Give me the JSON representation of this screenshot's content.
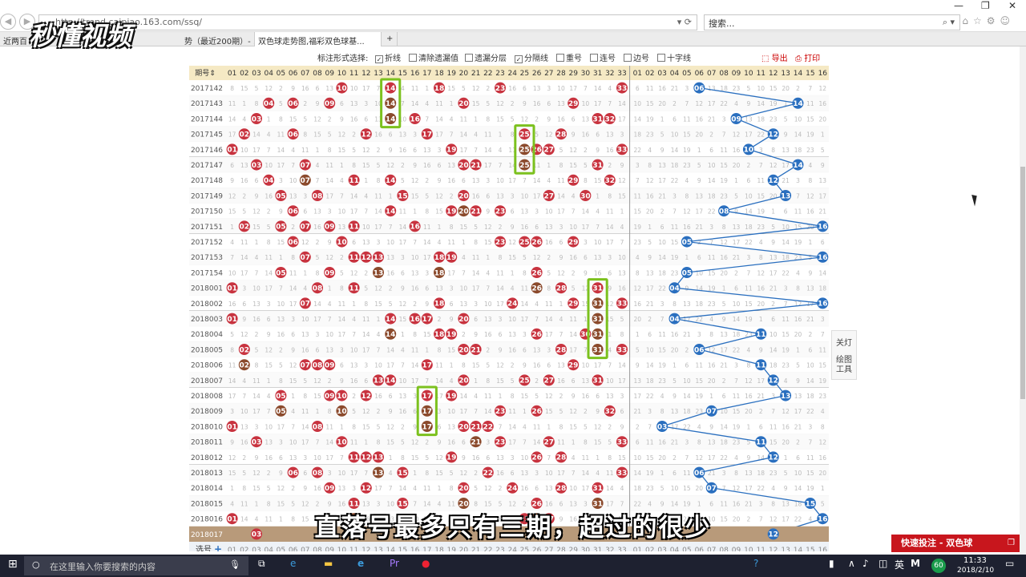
{
  "browser": {
    "address": "http://trend.caipiao.163.com/ssq/",
    "search_placeholder": "搜索...",
    "back_icon": "back-arrow-icon",
    "forward_icon": "forward-arrow-icon"
  },
  "tabs": [
    {
      "label": "近两百",
      "active": false
    },
    {
      "label": "势（最近200期）- ...",
      "active": false
    },
    {
      "label": "双色球走势图,福彩双色球基...",
      "active": true
    }
  ],
  "watermark": {
    "logo": "秒懂视频"
  },
  "toolbar": {
    "label": "标注形式选择:",
    "options": [
      {
        "label": "折线",
        "checked": true
      },
      {
        "label": "清除遗漏值",
        "checked": false
      },
      {
        "label": "遗漏分层",
        "checked": false
      },
      {
        "label": "分隔线",
        "checked": true
      },
      {
        "label": "重号",
        "checked": false
      },
      {
        "label": "连号",
        "checked": false
      },
      {
        "label": "边号",
        "checked": false
      },
      {
        "label": "十字线",
        "checked": false
      }
    ],
    "export": "导出",
    "print": "打印"
  },
  "table": {
    "period_header": "期号",
    "red_headers": [
      "01",
      "02",
      "03",
      "04",
      "05",
      "06",
      "07",
      "08",
      "09",
      "10",
      "11",
      "12",
      "13",
      "14",
      "15",
      "16",
      "17",
      "18",
      "19",
      "20",
      "21",
      "22",
      "23",
      "24",
      "25",
      "26",
      "27",
      "28",
      "29",
      "30",
      "31",
      "32",
      "33"
    ],
    "blue_headers": [
      "01",
      "02",
      "03",
      "04",
      "05",
      "06",
      "07",
      "08",
      "09",
      "10",
      "11",
      "12",
      "13",
      "14",
      "15",
      "16"
    ],
    "rows": [
      {
        "p": "2017142",
        "r": [
          10,
          14,
          18,
          23,
          33
        ],
        "b": 6
      },
      {
        "p": "2017143",
        "r": [
          4,
          6,
          9,
          14,
          20,
          29
        ],
        "b": 14
      },
      {
        "p": "2017144",
        "r": [
          3,
          14,
          16,
          31,
          32
        ],
        "b": 9
      },
      {
        "p": "2017145",
        "r": [
          2,
          6,
          12,
          17,
          25,
          28
        ],
        "b": 12
      },
      {
        "p": "2017146",
        "r": [
          1,
          19,
          25,
          26,
          27,
          33
        ],
        "b": 10
      },
      {
        "p": "2017147",
        "r": [
          3,
          7,
          20,
          21,
          25,
          31
        ],
        "b": 14
      },
      {
        "p": "2017148",
        "r": [
          4,
          7,
          11,
          14,
          29,
          32
        ],
        "b": 12
      },
      {
        "p": "2017149",
        "r": [
          5,
          8,
          15,
          20,
          27,
          30
        ],
        "b": 13
      },
      {
        "p": "2017150",
        "r": [
          6,
          14,
          19,
          20,
          21,
          23
        ],
        "b": 8
      },
      {
        "p": "2017151",
        "r": [
          2,
          5,
          7,
          9,
          11,
          16
        ],
        "b": 16
      },
      {
        "p": "2017152",
        "r": [
          6,
          10,
          23,
          25,
          26,
          29
        ],
        "b": 5
      },
      {
        "p": "2017153",
        "r": [
          7,
          11,
          12,
          13,
          18,
          19
        ],
        "b": 16
      },
      {
        "p": "2017154",
        "r": [
          5,
          9,
          13,
          18,
          26
        ],
        "b": 5
      },
      {
        "p": "2018001",
        "r": [
          1,
          8,
          11,
          26,
          28,
          31
        ],
        "b": 4
      },
      {
        "p": "2018002",
        "r": [
          7,
          18,
          24,
          29,
          31,
          33
        ],
        "b": 16
      },
      {
        "p": "2018003",
        "r": [
          1,
          14,
          16,
          17,
          20,
          31
        ],
        "b": 4
      },
      {
        "p": "2018004",
        "r": [
          14,
          18,
          19,
          26,
          30,
          31
        ],
        "b": 11
      },
      {
        "p": "2018005",
        "r": [
          2,
          20,
          21,
          28,
          31,
          33
        ],
        "b": 6
      },
      {
        "p": "2018006",
        "r": [
          2,
          7,
          8,
          9,
          17,
          29
        ],
        "b": 11
      },
      {
        "p": "2018007",
        "r": [
          13,
          14,
          20,
          25,
          27,
          31
        ],
        "b": 12
      },
      {
        "p": "2018008",
        "r": [
          5,
          9,
          10,
          12,
          17,
          19
        ],
        "b": 13
      },
      {
        "p": "2018009",
        "r": [
          5,
          10,
          17,
          23,
          26,
          32
        ],
        "b": 7
      },
      {
        "p": "2018010",
        "r": [
          1,
          8,
          17,
          20,
          21,
          22
        ],
        "b": 3
      },
      {
        "p": "2018011",
        "r": [
          3,
          10,
          21,
          23,
          27,
          33
        ],
        "b": 11
      },
      {
        "p": "2018012",
        "r": [
          11,
          12,
          13,
          19,
          26,
          28
        ],
        "b": 12
      },
      {
        "p": "2018013",
        "r": [
          6,
          8,
          13,
          15,
          22,
          33
        ],
        "b": 6
      },
      {
        "p": "2018014",
        "r": [
          9,
          12,
          20,
          24,
          28,
          31
        ],
        "b": 7
      },
      {
        "p": "2018015",
        "r": [
          11,
          15,
          20,
          26,
          31
        ],
        "b": 15
      },
      {
        "p": "2018016",
        "r": [
          1,
          11,
          25,
          26,
          27
        ],
        "b": 16
      }
    ],
    "partial_row": {
      "period": "2018017",
      "shown_red": [
        3
      ],
      "shown_blue": 12
    },
    "footer_label": "选号"
  },
  "highlights": [
    {
      "col": 14,
      "from": "2017142",
      "to": "2017144"
    },
    {
      "col": 25,
      "from": "2017145",
      "to": "2017147"
    },
    {
      "col": 31,
      "from": "2018001",
      "to": "2018005"
    },
    {
      "col": 17,
      "from": "2018008",
      "to": "2018010"
    }
  ],
  "side_panel": {
    "lights": "关灯",
    "tools": "绘图工具"
  },
  "caption": "直落号最多只有三期，超过的很少",
  "ad": {
    "label": "快速投注 - 双色球"
  },
  "taskbar": {
    "search_placeholder": "在这里输入你要搜索的内容",
    "time": "11:33",
    "date": "2018/2/10",
    "ime": "英",
    "ime_m": "M",
    "battery": "60"
  },
  "colors": {
    "red_ball": "#c8333f",
    "brown_ball": "#8b4a2c",
    "blue_ball": "#2a6fbf",
    "highlight": "#7cc11e",
    "header_bg": "#f5e9c4"
  }
}
